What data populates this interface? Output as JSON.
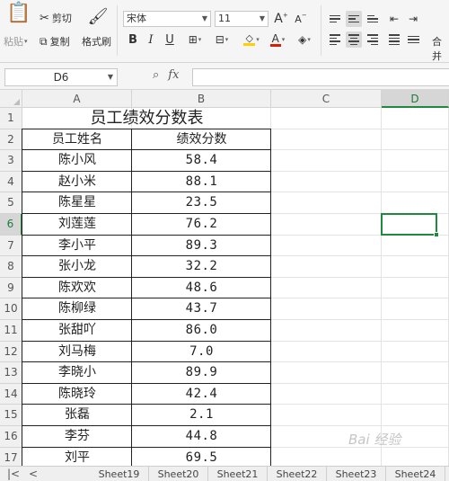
{
  "ribbon": {
    "clipboard": {
      "paste_label": "粘贴",
      "cut_label": "剪切",
      "copy_label": "复制",
      "format_painter_label": "格式刷"
    },
    "font": {
      "font_name": "宋体",
      "font_size": "11",
      "grow_label": "A",
      "shrink_label": "A",
      "bold_label": "B",
      "italic_label": "I",
      "underline_label": "U",
      "font_color_label": "A",
      "font_color": "#d81e06",
      "fill_color": "#ffd000"
    },
    "merge_label": "合并"
  },
  "formula_bar": {
    "name_box": "D6",
    "fx_label": "fx",
    "formula": ""
  },
  "columns": [
    "A",
    "B",
    "C",
    "D"
  ],
  "rows": [
    "1",
    "2",
    "3",
    "4",
    "5",
    "6",
    "7",
    "8",
    "9",
    "10",
    "11",
    "12",
    "13",
    "14",
    "15",
    "16",
    "17"
  ],
  "active_column": "D",
  "active_row": "6",
  "sheet": {
    "title": "员工绩效分数表",
    "headers": {
      "name": "员工姓名",
      "score": "绩效分数"
    },
    "records": [
      {
        "name": "陈小风",
        "score": "58.4"
      },
      {
        "name": "赵小米",
        "score": "88.1"
      },
      {
        "name": "陈星星",
        "score": "23.5"
      },
      {
        "name": "刘莲莲",
        "score": "76.2"
      },
      {
        "name": "李小平",
        "score": "89.3"
      },
      {
        "name": "张小龙",
        "score": "32.2"
      },
      {
        "name": "陈欢欢",
        "score": "48.6"
      },
      {
        "name": "陈柳绿",
        "score": "43.7"
      },
      {
        "name": "张甜吖",
        "score": "86.0"
      },
      {
        "name": "刘马梅",
        "score": "7.0"
      },
      {
        "name": "李晓小",
        "score": "89.9"
      },
      {
        "name": "陈晓玲",
        "score": "42.4"
      },
      {
        "name": "张磊",
        "score": "2.1"
      },
      {
        "name": "李芬",
        "score": "44.8"
      },
      {
        "name": "刘平",
        "score": "69.5"
      }
    ]
  },
  "sheet_tabs": [
    "Sheet19",
    "Sheet20",
    "Sheet21",
    "Sheet22",
    "Sheet23",
    "Sheet24"
  ],
  "tab_nav": {
    "first": "|<",
    "prev": "<"
  },
  "watermark": "Bai 经验"
}
